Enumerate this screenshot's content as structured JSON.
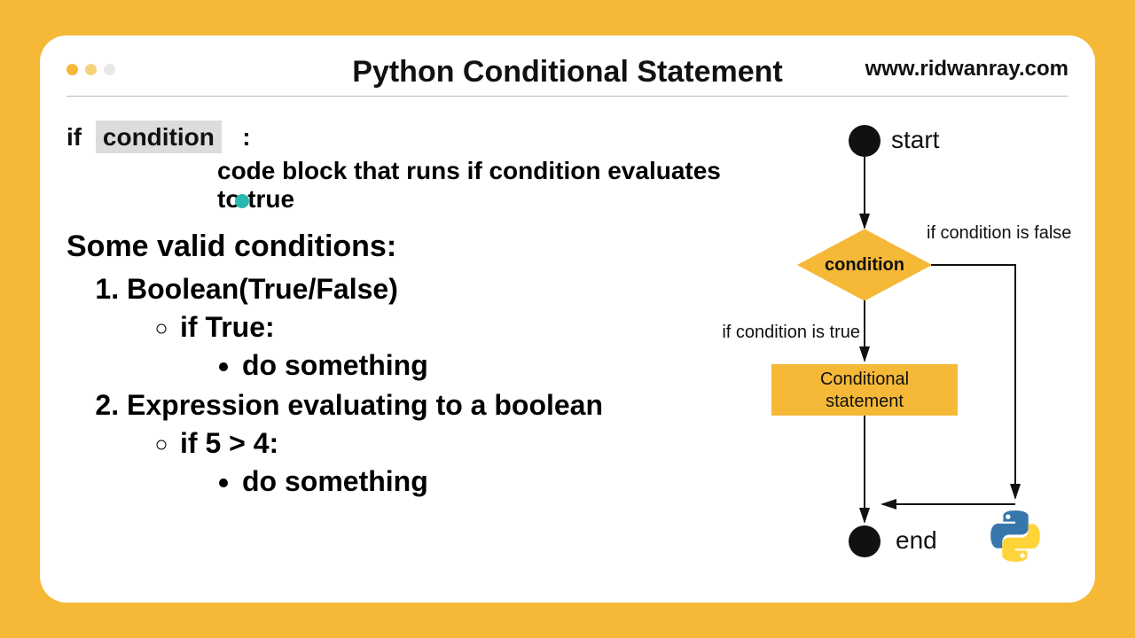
{
  "header": {
    "title": "Python Conditional Statement",
    "url": "www.ridwanray.com",
    "dots": [
      "#f5b837",
      "#f5d27a",
      "#e8e8e8"
    ]
  },
  "syntax": {
    "if_kw": "if",
    "condition_label": "condition",
    "colon": ":",
    "code_block": "code block that runs if condition evaluates to true"
  },
  "subtitle": "Some valid conditions:",
  "list": {
    "item1": {
      "title": "Boolean(True/False)",
      "sub": "if True:",
      "inner": "do something"
    },
    "item2": {
      "title": "Expression evaluating to a boolean",
      "sub": "if 5 > 4:",
      "inner": "do something"
    }
  },
  "flowchart": {
    "start": "start",
    "condition": "condition",
    "true_label": "if condition is true",
    "false_label": "if condition is false",
    "box_line1": "Conditional",
    "box_line2": "statement",
    "end": "end"
  },
  "chart_data": {
    "type": "flowchart",
    "nodes": [
      {
        "id": "start",
        "type": "terminal",
        "label": "start"
      },
      {
        "id": "cond",
        "type": "decision",
        "label": "condition"
      },
      {
        "id": "stmt",
        "type": "process",
        "label": "Conditional statement"
      },
      {
        "id": "end",
        "type": "terminal",
        "label": "end"
      }
    ],
    "edges": [
      {
        "from": "start",
        "to": "cond"
      },
      {
        "from": "cond",
        "to": "stmt",
        "label": "if condition is true"
      },
      {
        "from": "cond",
        "to": "end",
        "label": "if condition is false"
      },
      {
        "from": "stmt",
        "to": "end"
      }
    ]
  }
}
